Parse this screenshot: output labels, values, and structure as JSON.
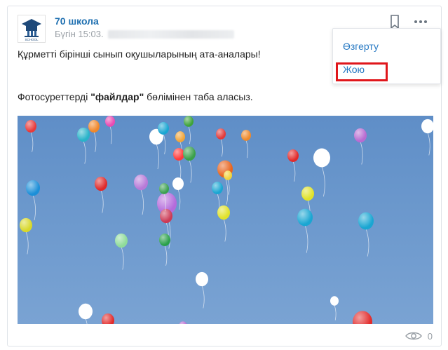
{
  "post": {
    "author": "70 школа",
    "time": "Бүгін 15:03.",
    "line1": "Құрметті бірінші сынып оқушыларының ата-аналары!",
    "line2_prefix": "Фотосуреттерді ",
    "line2_bold": "\"файлдар\"",
    "line2_suffix": " бөлімінен таба аласыз.",
    "views": "0",
    "avatar_caption": "SCHOOL"
  },
  "menu": {
    "edit": "Өзгерту",
    "delete": "Жою"
  },
  "colors": {
    "link": "#1e6fb0",
    "menu_link": "#2a7bc4",
    "highlight": "#e0161b",
    "sky": "#6a97cc"
  },
  "icons": [
    "school-logo-icon",
    "bookmark-icon",
    "more-options-icon",
    "eye-icon"
  ]
}
